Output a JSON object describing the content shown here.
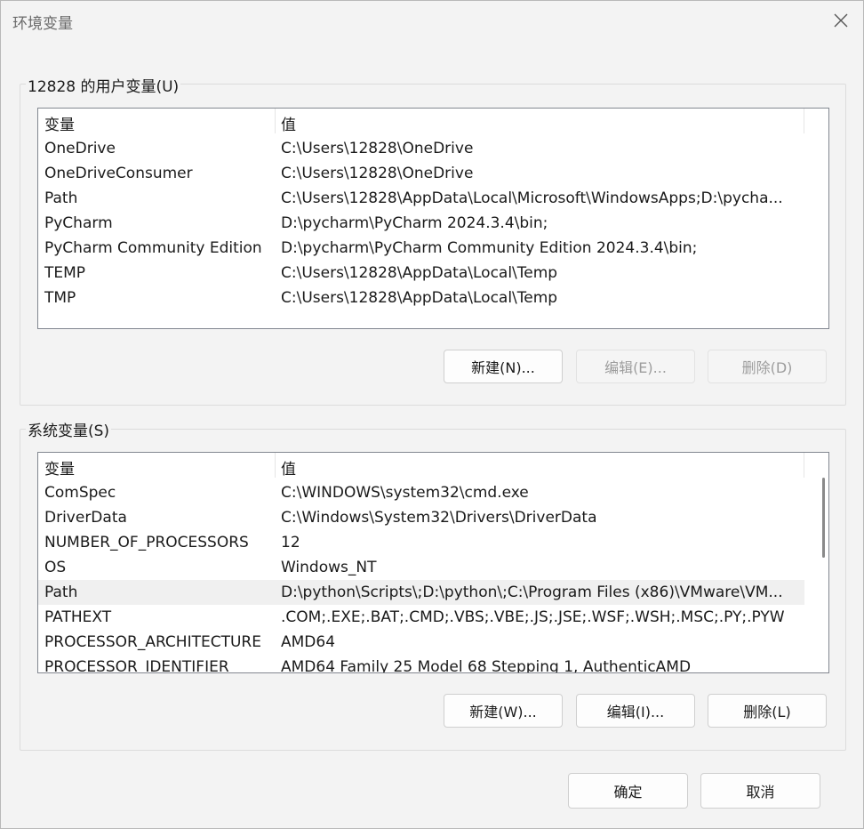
{
  "window": {
    "title": "环境变量"
  },
  "user_vars": {
    "group_label": "12828 的用户变量(U)",
    "columns": [
      "变量",
      "值"
    ],
    "rows": [
      {
        "name": "OneDrive",
        "value": "C:\\Users\\12828\\OneDrive"
      },
      {
        "name": "OneDriveConsumer",
        "value": "C:\\Users\\12828\\OneDrive"
      },
      {
        "name": "Path",
        "value": "C:\\Users\\12828\\AppData\\Local\\Microsoft\\WindowsApps;D:\\pycha..."
      },
      {
        "name": "PyCharm",
        "value": "D:\\pycharm\\PyCharm 2024.3.4\\bin;"
      },
      {
        "name": "PyCharm Community Edition",
        "value": "D:\\pycharm\\PyCharm Community Edition 2024.3.4\\bin;"
      },
      {
        "name": "TEMP",
        "value": "C:\\Users\\12828\\AppData\\Local\\Temp"
      },
      {
        "name": "TMP",
        "value": "C:\\Users\\12828\\AppData\\Local\\Temp"
      }
    ],
    "buttons": {
      "new": "新建(N)...",
      "edit": "编辑(E)...",
      "delete": "删除(D)"
    }
  },
  "system_vars": {
    "group_label": "系统变量(S)",
    "columns": [
      "变量",
      "值"
    ],
    "rows": [
      {
        "name": "ComSpec",
        "value": "C:\\WINDOWS\\system32\\cmd.exe"
      },
      {
        "name": "DriverData",
        "value": "C:\\Windows\\System32\\Drivers\\DriverData"
      },
      {
        "name": "NUMBER_OF_PROCESSORS",
        "value": "12"
      },
      {
        "name": "OS",
        "value": "Windows_NT"
      },
      {
        "name": "Path",
        "value": "D:\\python\\Scripts\\;D:\\python\\;C:\\Program Files (x86)\\VMware\\VM..."
      },
      {
        "name": "PATHEXT",
        "value": ".COM;.EXE;.BAT;.CMD;.VBS;.VBE;.JS;.JSE;.WSF;.WSH;.MSC;.PY;.PYW"
      },
      {
        "name": "PROCESSOR_ARCHITECTURE",
        "value": "AMD64"
      },
      {
        "name": "PROCESSOR_IDENTIFIER",
        "value": "AMD64 Family 25 Model 68 Stepping 1, AuthenticAMD"
      }
    ],
    "selected_row": "Path",
    "buttons": {
      "new": "新建(W)...",
      "edit": "编辑(I)...",
      "delete": "删除(L)"
    }
  },
  "footer": {
    "ok": "确定",
    "cancel": "取消"
  }
}
